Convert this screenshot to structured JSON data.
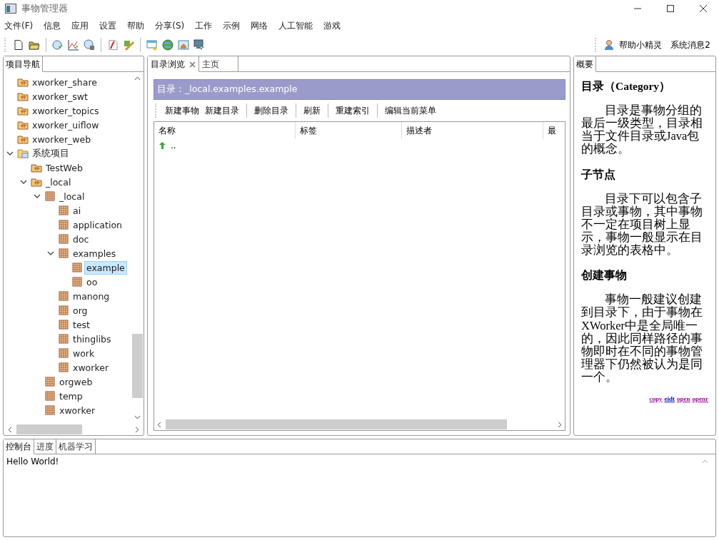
{
  "window": {
    "title": "事物管理器"
  },
  "menu": [
    "文件(F)",
    "信息",
    "应用",
    "设置",
    "帮助",
    "分享(S)",
    "工作",
    "示例",
    "网络",
    "人工智能",
    "游戏"
  ],
  "toolbar": {
    "groups": [
      [
        {
          "kind": "new-file"
        },
        {
          "kind": "open-folder"
        }
      ],
      [
        {
          "kind": "clock-go"
        },
        {
          "kind": "chart-go"
        },
        {
          "kind": "clock-gear"
        }
      ],
      [
        {
          "kind": "pdf"
        },
        {
          "kind": "edit-wand"
        }
      ],
      [
        {
          "kind": "window-key"
        },
        {
          "kind": "globe"
        },
        {
          "kind": "home-window"
        },
        {
          "kind": "monitor-go"
        }
      ]
    ],
    "helper": "帮助小精灵",
    "messages": "系统消息2"
  },
  "navigator": {
    "tabs": [
      {
        "label": "项目导航",
        "selected": true
      }
    ],
    "tree": [
      {
        "label": "xworker_share",
        "kind": "project"
      },
      {
        "label": "xworker_swt",
        "kind": "project"
      },
      {
        "label": "xworker_topics",
        "kind": "project"
      },
      {
        "label": "xworker_uiflow",
        "kind": "project"
      },
      {
        "label": "xworker_web",
        "kind": "project"
      },
      {
        "label": "系统项目",
        "kind": "group",
        "expanded": true,
        "children": [
          {
            "label": "TestWeb",
            "kind": "project"
          },
          {
            "label": "_local",
            "kind": "project",
            "expanded": true,
            "children": [
              {
                "label": "_local",
                "kind": "package",
                "expanded": true,
                "children": [
                  {
                    "label": "ai",
                    "kind": "package"
                  },
                  {
                    "label": "application",
                    "kind": "package"
                  },
                  {
                    "label": "doc",
                    "kind": "package"
                  },
                  {
                    "label": "examples",
                    "kind": "package",
                    "expanded": true,
                    "children": [
                      {
                        "label": "example",
                        "kind": "package",
                        "selected": true
                      },
                      {
                        "label": "oo",
                        "kind": "package",
                        "selected": false
                      }
                    ]
                  },
                  {
                    "label": "manong",
                    "kind": "package"
                  },
                  {
                    "label": "org",
                    "kind": "package"
                  },
                  {
                    "label": "test",
                    "kind": "package"
                  },
                  {
                    "label": "thinglibs",
                    "kind": "package"
                  },
                  {
                    "label": "work",
                    "kind": "package"
                  },
                  {
                    "label": "xworker",
                    "kind": "package"
                  }
                ]
              },
              {
                "label": "orgweb",
                "kind": "package"
              },
              {
                "label": "temp",
                "kind": "package"
              },
              {
                "label": "xworker",
                "kind": "package"
              }
            ]
          }
        ]
      }
    ]
  },
  "browser": {
    "tabs": [
      {
        "label": "目录浏览",
        "selected": true,
        "closable": true
      },
      {
        "label": "主页",
        "selected": false,
        "closable": false
      }
    ],
    "path": "目录：_local.examples.example",
    "actions": [
      [
        "新建事物",
        "新建目录"
      ],
      [
        "删除目录"
      ],
      [
        "刷新"
      ],
      [
        "重建索引"
      ],
      [
        "编辑当前菜单"
      ]
    ],
    "table": {
      "columns": [
        "名称",
        "标签",
        "描述者",
        "最"
      ],
      "rows": [
        {
          "name": ".."
        }
      ]
    }
  },
  "summary": {
    "tabs": [
      {
        "label": "概要",
        "selected": true
      }
    ],
    "sections": [
      {
        "heading": "目录（Category）",
        "text": "目录是事物分组的最后一级类型，目录相当于文件目录或Java包的概念。"
      },
      {
        "heading": "子节点",
        "text": "目录下可以包含子目录或事物，其中事物不一定在项目树上显示，事物一般显示在目录浏览的表格中。"
      },
      {
        "heading": "创建事物",
        "text": "事物一般建议创建到目录下，由于事物在XWorker中是全局唯一的，因此同样路径的事物即时在不同的事物管理器下仍然被认为是同一个。"
      }
    ],
    "links": [
      {
        "label": "copy",
        "color": "#990099"
      },
      {
        "label": "eidt",
        "color": "#0000cc"
      },
      {
        "label": "open",
        "color": "#990099"
      },
      {
        "label": "openr",
        "color": "#990099"
      }
    ]
  },
  "console": {
    "tabs": [
      {
        "label": "控制台",
        "selected": true
      },
      {
        "label": "进度",
        "selected": false
      },
      {
        "label": "机器学习",
        "selected": false
      }
    ],
    "output": "Hello World!"
  }
}
